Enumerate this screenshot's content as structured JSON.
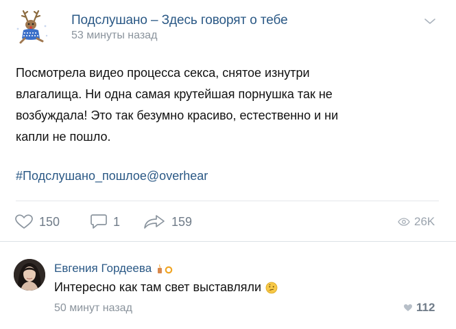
{
  "post": {
    "group_name": "Подслушано – Здесь говорят о тебе",
    "time": "53 минуты назад",
    "text_lines": [
      "Посмотрела видео процесса секса, снятое изнутри",
      "влагалища. Ни одна самая крутейшая порнушка так не",
      "возбуждала! Это так безумно красиво, естественно и ни",
      "капли не пошло."
    ],
    "hashtag": "#Подслушано_пошлое@overhear",
    "likes": "150",
    "comments": "1",
    "shares": "159",
    "views": "26K",
    "icons": {
      "avatar": "deer-avatar-icon",
      "menu": "chevron-down-icon",
      "like": "heart-icon",
      "comment": "comment-icon",
      "share": "share-icon",
      "views": "eye-icon"
    }
  },
  "comment": {
    "author": "Евгения Гордеева",
    "text": "Интересно как там свет выставляли",
    "time": "50 минут назад",
    "likes": "112",
    "icons": {
      "badge": "candle-icon",
      "badge2": "ring-icon",
      "emoji": "thinking-face-emoji",
      "like": "heart-icon"
    }
  },
  "colors": {
    "link": "#2a5885",
    "meta": "#8a939c",
    "action": "#6f7b88",
    "divider": "#e4e6ea"
  }
}
